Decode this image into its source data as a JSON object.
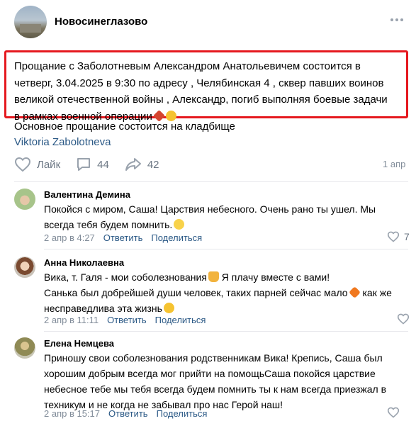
{
  "group": {
    "name": "Новосинеглазово"
  },
  "post": {
    "lines": [
      "Прощание с Заболотневым Александром Анатольевичем состоится в",
      "четверг, 3.04.2025 в 9:30 по адресу , Челябинская 4 , сквер павших воинов",
      "великой отечественной войны , Александр, погиб выполняя боевые задачи",
      "в рамках военной операции"
    ],
    "extra": "Основное прощание состоится на кладбище",
    "author": "Viktoria Zabolotneva",
    "like_label": "Лайк",
    "comments_count": "44",
    "shares_count": "42",
    "date": "1 апр"
  },
  "comments": [
    {
      "name": "Валентина Демина",
      "lines": [
        "Покойся с миром, Саша! Царствия небесного. Очень рано ты ушел. Мы",
        "всегда тебя будем помнить."
      ],
      "date": "2 апр в 4:27",
      "reply": "Ответить",
      "share": "Поделиться",
      "likes": "7"
    },
    {
      "name": "Анна Николаевна",
      "lines": [
        "Вика, т. Галя - мои соболезнования",
        " Я плачу вместе с вами!",
        "Санька был добрейшей души человек, таких парней сейчас мало",
        " как же",
        "несправедлива эта жизнь"
      ],
      "date": "2 апр в 11:11",
      "reply": "Ответить",
      "share": "Поделиться"
    },
    {
      "name": "Елена Немцева",
      "lines": [
        "Приношу свои соболезнования родственникам Вика! Крепись, Саша был",
        "хорошим добрым всегда мог прийти на помощьСаша покойся царствие",
        "небесное тебе мы тебя всегда будем помнить ты к нам всегда приезжал в",
        "техникум и не когда не забывал про нас Герой наш!"
      ],
      "date": "2 апр в 15:17",
      "reply": "Ответить",
      "share": "Поделиться"
    }
  ],
  "colors": {
    "link": "#2a5885",
    "highlight_border": "#e5191f",
    "muted": "#818c99"
  }
}
